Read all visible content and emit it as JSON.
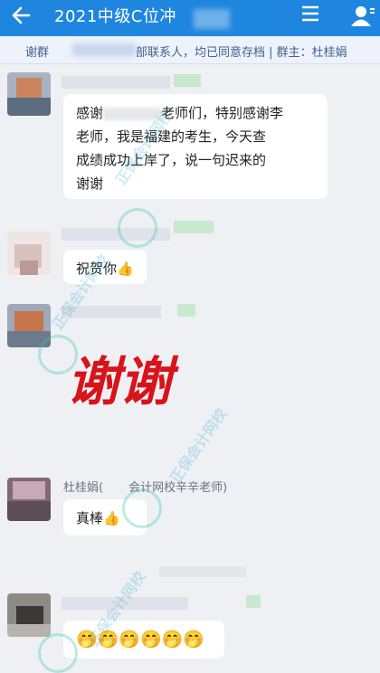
{
  "header": {
    "back_icon": "arrow-left-icon",
    "title": "2021中级C位冲",
    "menu_icon": "hamburger-menu-icon",
    "members_icon": "person-icon"
  },
  "notice": {
    "part1": "谢群",
    "part2": "部联系人，均已同意存档 | 群主：杜桂娟"
  },
  "messages": [
    {
      "lines": [
        "感谢",
        "老师们，特别感谢李",
        "老师，我是福建的考生，今天查",
        "成绩成功上岸了，说一句迟来的",
        "谢谢"
      ]
    },
    {
      "text": "祝贺你",
      "emoji": "👍"
    },
    {
      "text": "谢谢",
      "style": "red-handwritten-image"
    },
    {
      "sender": "杜桂娟(",
      "sender_rest": "会计网校辛辛老师)",
      "text": "真棒",
      "emoji": "👍"
    },
    {
      "emoji_row": "🤭🤭🤭🤭🤭🤭"
    }
  ],
  "watermark": {
    "brand": "正保会计网校",
    "site": "www.chinaacc.com",
    "color": "#1aa2c7"
  },
  "colors": {
    "header_bg": "#1f86df",
    "chat_bg": "#eef0f4",
    "notice_text": "#40618e",
    "handwriting_red": "#d8131a"
  }
}
